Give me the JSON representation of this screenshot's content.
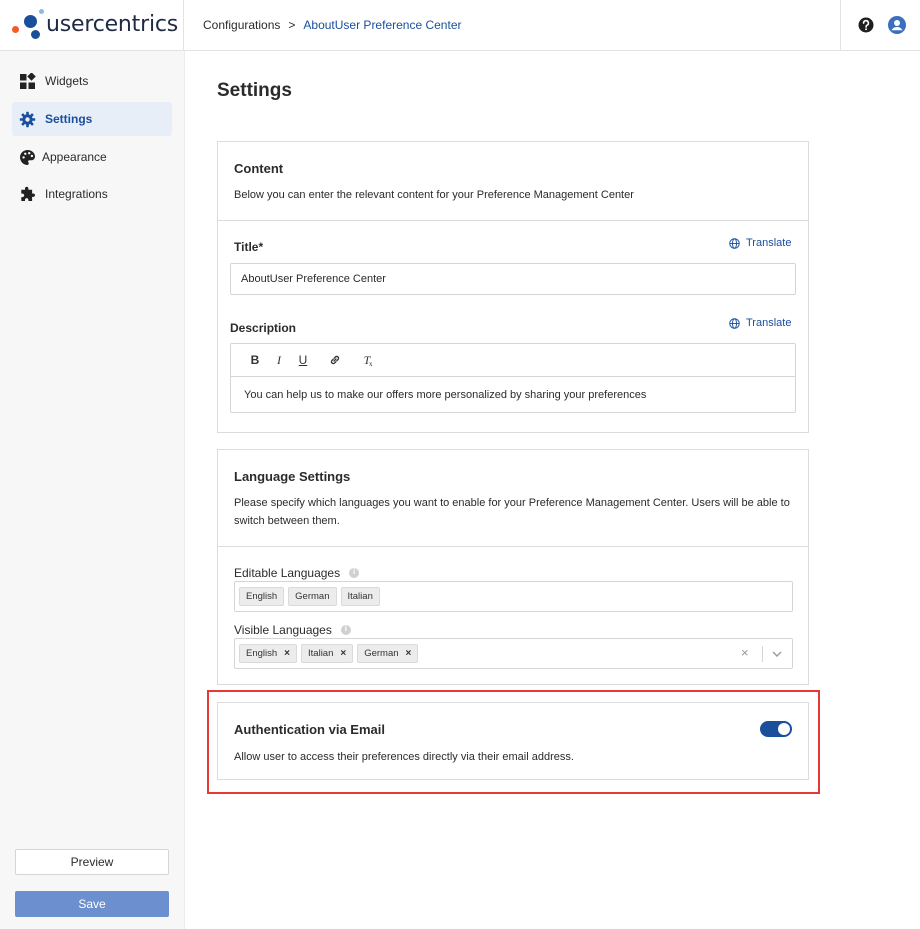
{
  "brand": {
    "name": "usercentrics"
  },
  "header": {
    "breadcrumb_root": "Configurations",
    "breadcrumb_sep": ">",
    "breadcrumb_current": "AboutUser Preference Center"
  },
  "sidebar": {
    "items": [
      {
        "label": "Widgets",
        "icon": "widgets-icon"
      },
      {
        "label": "Settings",
        "icon": "gear-icon"
      },
      {
        "label": "Appearance",
        "icon": "palette-icon"
      },
      {
        "label": "Integrations",
        "icon": "puzzle-icon"
      }
    ],
    "preview_label": "Preview",
    "save_label": "Save"
  },
  "page": {
    "title": "Settings"
  },
  "content": {
    "title": "Content",
    "description": "Below you can enter the relevant content for your Preference Management Center",
    "title_label": "Title",
    "required_mark": "*",
    "translate_label": "Translate",
    "title_value": "AboutUser Preference Center",
    "description_label": "Description",
    "toolbar": {
      "bold": "B",
      "italic": "I",
      "underline": "U",
      "clear": "T"
    },
    "description_value": "You can help us to make our offers more personalized by sharing your preferences"
  },
  "language": {
    "title": "Language Settings",
    "description": "Please specify which languages you want to enable for your Preference Management Center. Users will be able to switch between them.",
    "editable_label": "Editable Languages",
    "editable": [
      "English",
      "German",
      "Italian"
    ],
    "visible_label": "Visible Languages",
    "visible": [
      "English",
      "Italian",
      "German"
    ],
    "remove_glyph": "×",
    "clear_glyph": "×"
  },
  "auth": {
    "title": "Authentication via Email",
    "description": "Allow user to access their preferences directly via their email address.",
    "enabled": true
  },
  "colors": {
    "accent": "#1a4f9c",
    "save_button": "#6b8fcf",
    "highlight": "#e53935",
    "logo_orange": "#f25c2b",
    "logo_blue": "#1a4f9c",
    "logo_light": "#8cb8e6"
  }
}
